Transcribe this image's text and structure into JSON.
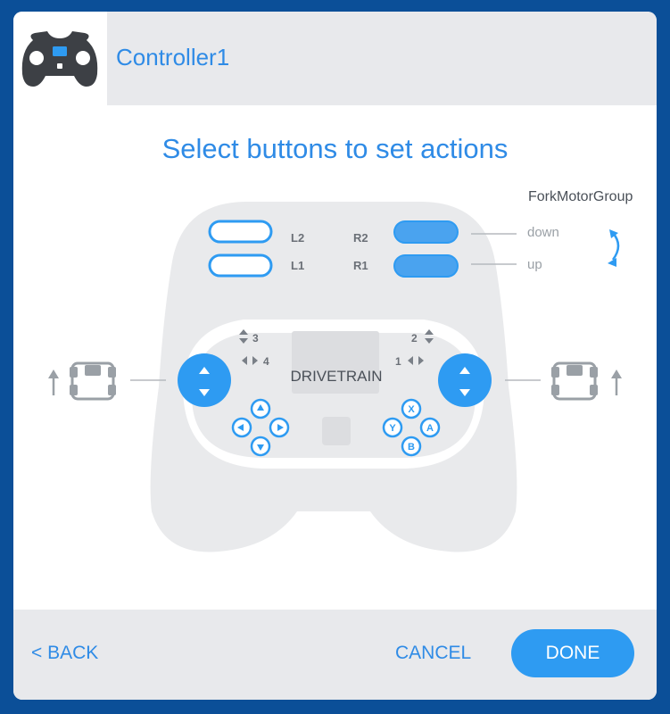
{
  "header": {
    "title": "Controller1",
    "icon": "gamepad-icon"
  },
  "prompt": "Select buttons to set actions",
  "controller": {
    "shoulder": {
      "l2": "L2",
      "l1": "L1",
      "r2": "R2",
      "r1": "R1"
    },
    "assignment_group": "ForkMotorGroup",
    "r2_action": "down",
    "r1_action": "up",
    "center_label": "DRIVETRAIN",
    "axis_3": "3",
    "axis_4": "4",
    "axis_2": "2",
    "axis_1": "1",
    "face_buttons": {
      "x": "X",
      "y": "Y",
      "a": "A",
      "b": "B"
    }
  },
  "colors": {
    "accent": "#2e9bf2",
    "accent_text": "#2f8be6",
    "controller_body": "#e9eaec",
    "muted": "#9aa0a6",
    "background": "#0b4f98"
  },
  "footer": {
    "back_label": "< BACK",
    "cancel_label": "CANCEL",
    "done_label": "DONE"
  }
}
